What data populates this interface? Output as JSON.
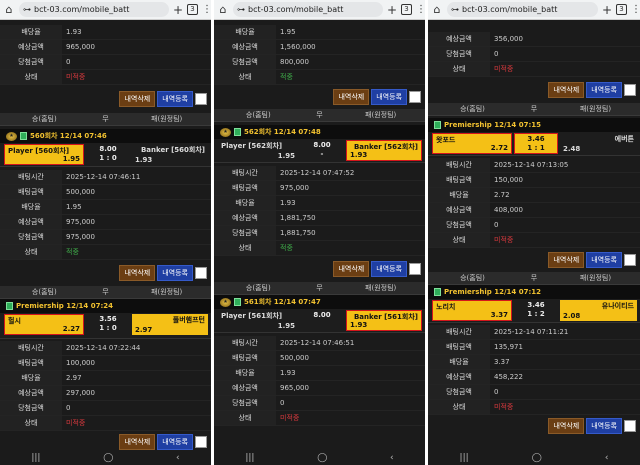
{
  "browser": {
    "url": "bct-03.com/mobile_batt",
    "tab_count": "3"
  },
  "labels": {
    "bet_time": "배팅시간",
    "bet_amount": "배팅금액",
    "odds": "배당율",
    "expected": "예상금액",
    "win_amount": "당첨금액",
    "status": "상태"
  },
  "buttons": {
    "delete": "내역삭제",
    "register": "내역등록"
  },
  "table_header": {
    "win": "승(홈팀)",
    "draw": "무",
    "lose": "패(원정팀)"
  },
  "navbar": {
    "recent": "|||",
    "home": "◯",
    "back": "‹"
  },
  "col0": {
    "top": {
      "odds": "1.93",
      "expected": "965,000",
      "win_amount": "0",
      "status": "미적중"
    },
    "b1": {
      "game": "560회차 12/14 07:46",
      "home": "Player [560회차]",
      "home_odds": "1.95",
      "mid_line1": "8.00",
      "mid_line2": "1 : 0",
      "away": "Banker [560회차]",
      "away_odds": "1.93",
      "time": "2025-12-14 07:46:11",
      "amount": "500,000",
      "odds": "1.95",
      "expected": "975,000",
      "win_amount": "975,000",
      "status": "적중"
    },
    "b2": {
      "game": "Premiership 12/14 07:24",
      "home": "헐시",
      "home_odds": "2.27",
      "mid_line1": "3.56",
      "mid_line2": "1 : 0",
      "away": "풀버햄프턴",
      "away_odds": "2.97",
      "time": "2025-12-14 07:22:44",
      "amount": "100,000",
      "odds": "2.97",
      "expected": "297,000",
      "win_amount": "0",
      "status": "미적중"
    }
  },
  "col1": {
    "top": {
      "odds": "1.95",
      "expected": "1,560,000",
      "win_amount": "800,000",
      "status": "적중"
    },
    "b1": {
      "game": "562회차 12/14 07:48",
      "home": "Player [562회차]",
      "home_odds": "1.95",
      "mid_line1": "8.00",
      "mid_line2": "-",
      "away": "Banker [562회차]",
      "away_odds": "1.93",
      "time": "2025-12-14 07:47:52",
      "amount": "975,000",
      "odds": "1.93",
      "expected": "1,881,750",
      "win_amount": "1,881,750",
      "status": "적중"
    },
    "b2": {
      "game": "561회차 12/14 07:47",
      "home": "Player [561회차]",
      "home_odds": "1.95",
      "mid_line1": "8.00",
      "mid_line2": "",
      "away": "Banker [561회차]",
      "away_odds": "1.93",
      "time": "2025-12-14 07:46:51",
      "amount": "500,000",
      "odds": "1.93",
      "expected": "965,000",
      "win_amount": "0",
      "status": "미적중"
    }
  },
  "col2": {
    "top": {
      "expected": "356,000",
      "win_amount": "0",
      "status": "미적중"
    },
    "b1": {
      "game": "Premiership 12/14 07:15",
      "home": "왓포드",
      "home_odds": "2.72",
      "mid_line1": "3.46",
      "mid_line2": "1 : 1",
      "away": "에버튼",
      "away_odds": "2.48",
      "time": "2025-12-14 07:13:05",
      "amount": "150,000",
      "odds": "2.72",
      "expected": "408,000",
      "win_amount": "0",
      "status": "미적중"
    },
    "b2": {
      "game": "Premiership 12/14 07:12",
      "home": "노리치",
      "home_odds": "3.37",
      "mid_line1": "3.46",
      "mid_line2": "1 : 2",
      "away": "유나이티드",
      "away_odds": "2.08",
      "time": "2025-12-14 07:11:21",
      "amount": "135,971",
      "odds": "3.37",
      "expected": "458,222",
      "win_amount": "0",
      "status": "미적중"
    }
  }
}
